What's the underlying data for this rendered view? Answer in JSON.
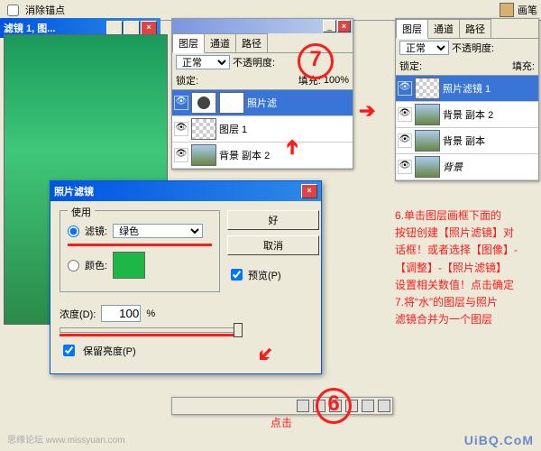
{
  "toolbar": {
    "clear_anchor": "消除锚点",
    "brush_label": "画笔"
  },
  "main_window": {
    "title": "滤镜 1, 图..."
  },
  "layers_panel_1": {
    "tabs": [
      "图层",
      "通道",
      "路径"
    ],
    "blend_mode": "正常",
    "opacity_label": "不透明度:",
    "opacity_value": "",
    "lock_label": "锁定:",
    "fill_label": "填充:",
    "fill_value": "100%",
    "layers": [
      {
        "name": "照片滤"
      },
      {
        "name": "图层 1"
      },
      {
        "name": "背景 副本 2"
      }
    ]
  },
  "layers_panel_2": {
    "tabs": [
      "图层",
      "通道",
      "路径"
    ],
    "blend_mode": "正常",
    "opacity_label": "不透明度:",
    "lock_label": "锁定:",
    "fill_label": "填充:",
    "layers": [
      {
        "name": "照片滤镜 1"
      },
      {
        "name": "背景 副本 2"
      },
      {
        "name": "背景 副本"
      },
      {
        "name": "背景"
      }
    ]
  },
  "dialog": {
    "title": "照片滤镜",
    "group_use": "使用",
    "filter_label": "滤镜:",
    "filter_value": "绿色",
    "color_label": "颜色:",
    "ok": "好",
    "cancel": "取消",
    "preview": "预览(P)",
    "density_label": "浓度(D):",
    "density_value": "100",
    "density_unit": "%",
    "preserve": "保留亮度(P)"
  },
  "annotations": {
    "step6": "6.单击图层画框下面的\n按钮创建【照片滤镜】对\n话框！或者选择【图像】-\n【调整】-【照片滤镜】\n设置相关数值！点击确定\n7.将“水”的图层与照片\n滤镜合并为一个图层",
    "click": "点击",
    "num6": "6",
    "num7": "7"
  },
  "footer": {
    "left": "思缘论坛  www.missyuan.com",
    "right": "UiBQ.CoM"
  }
}
